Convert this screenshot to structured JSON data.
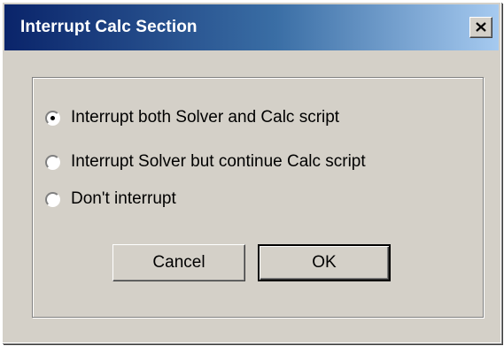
{
  "window": {
    "title": "Interrupt Calc Section",
    "close_icon": "close-icon"
  },
  "options": [
    {
      "label": "Interrupt both Solver and Calc script",
      "selected": true
    },
    {
      "label": "Interrupt Solver but continue Calc script",
      "selected": false
    },
    {
      "label": "Don't interrupt",
      "selected": false
    }
  ],
  "buttons": {
    "cancel_label": "Cancel",
    "ok_label": "OK"
  },
  "colors": {
    "titlebar_start": "#0a246a",
    "titlebar_end": "#a6caf0",
    "dialog_face": "#d4d0c8"
  }
}
